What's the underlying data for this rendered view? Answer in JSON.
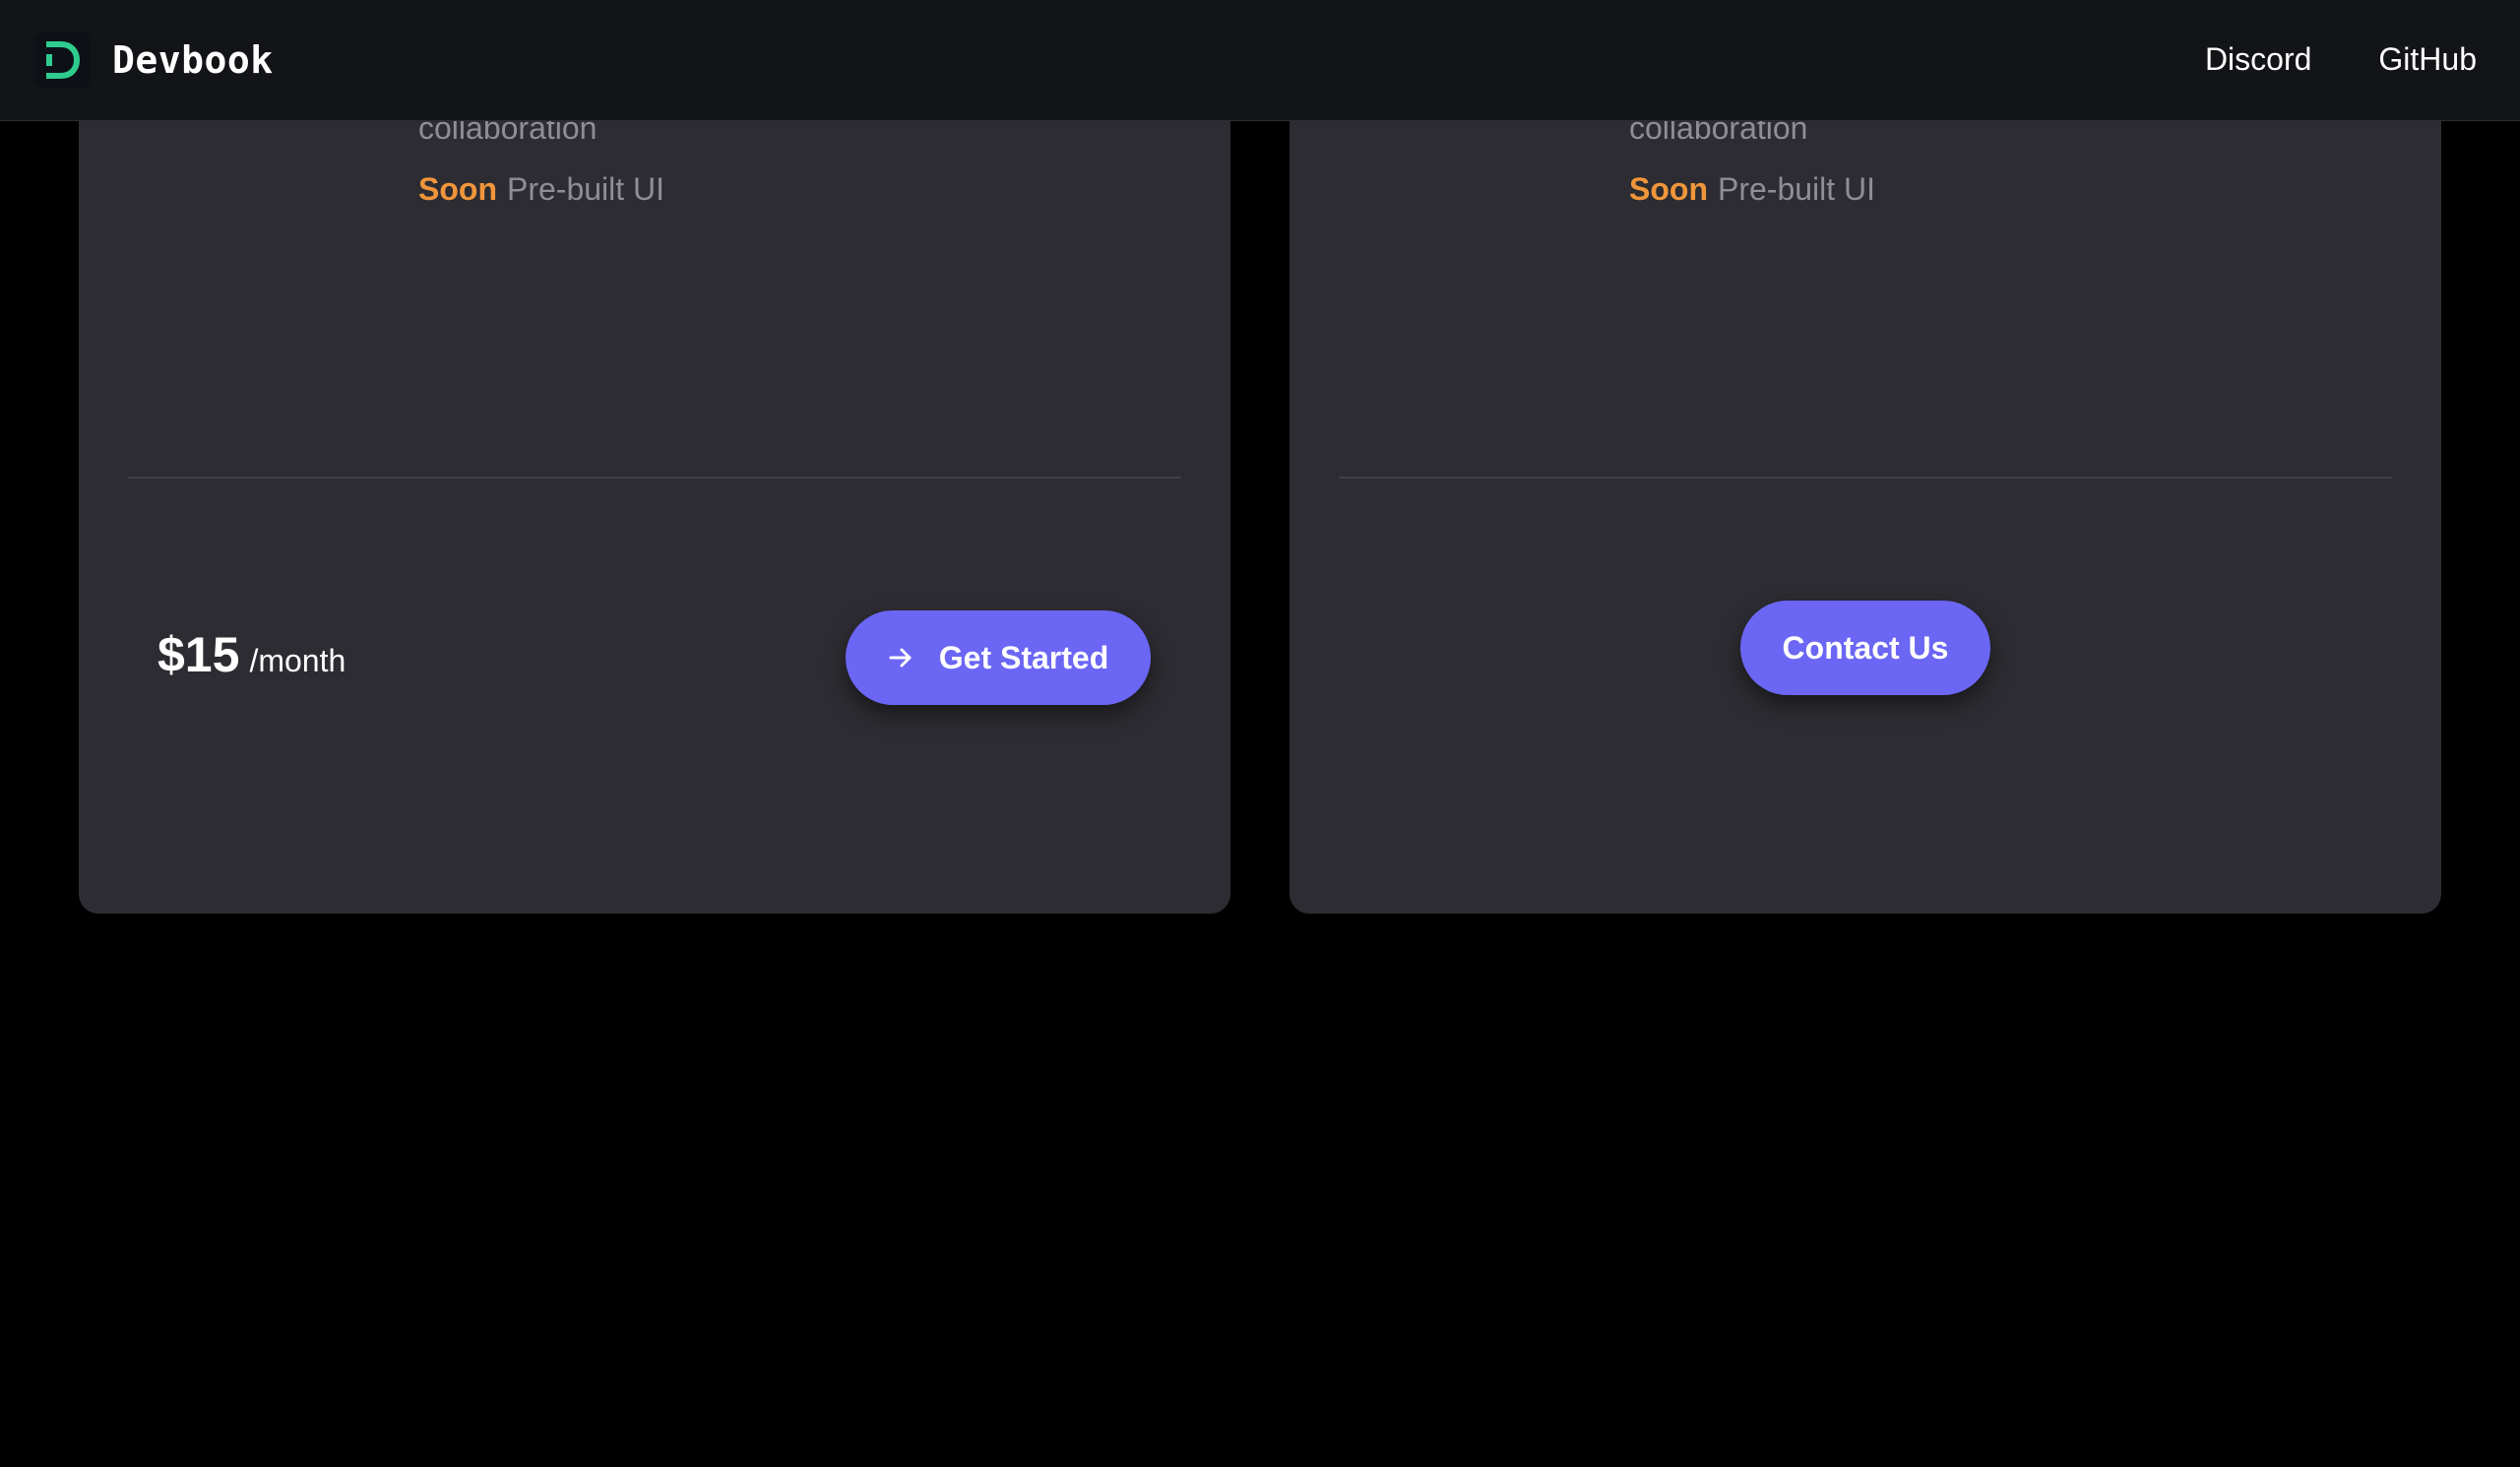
{
  "navbar": {
    "brand_name": "Devbook",
    "links": [
      {
        "label": "Discord"
      },
      {
        "label": "GitHub"
      }
    ]
  },
  "colors": {
    "accent": "#6b66f4",
    "soon": "#f0963a",
    "logo": "#2ecc8f",
    "card_bg": "#2c2c32",
    "nav_bg": "#131417"
  },
  "cards": [
    {
      "feature_partial": "collaboration",
      "soon_tag": "Soon",
      "soon_feature": "Pre-built UI",
      "price_amount": "$15",
      "price_period": "/month",
      "cta_label": "Get Started",
      "cta_icon": "arrow-right-icon"
    },
    {
      "feature_partial": "collaboration",
      "soon_tag": "Soon",
      "soon_feature": "Pre-built UI",
      "cta_label": "Contact Us"
    }
  ]
}
